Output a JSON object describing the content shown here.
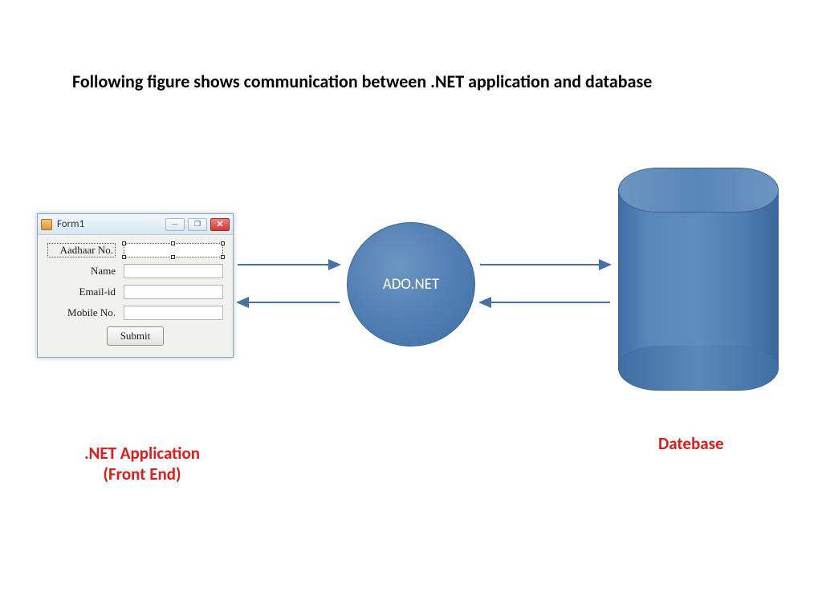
{
  "heading": "Following figure shows  communication between .NET application and database",
  "form": {
    "title": "Form1",
    "fields": {
      "aadhaar_label": "Aadhaar No.",
      "name_label": "Name",
      "email_label": "Email-id",
      "mobile_label": "Mobile No."
    },
    "submit_label": "Submit",
    "window_controls": {
      "minimize": "—",
      "maximize": "❐",
      "close": "✕"
    }
  },
  "adonet_label": "ADO.NET",
  "captions": {
    "net_application": ".NET Application\n(Front End)",
    "database": "Datebase"
  },
  "icons": {
    "form_app_icon": "form-app-icon"
  },
  "colors": {
    "shape_fill": "#4f7eb3",
    "arrow": "#4472a8",
    "caption": "#e21a1a"
  }
}
